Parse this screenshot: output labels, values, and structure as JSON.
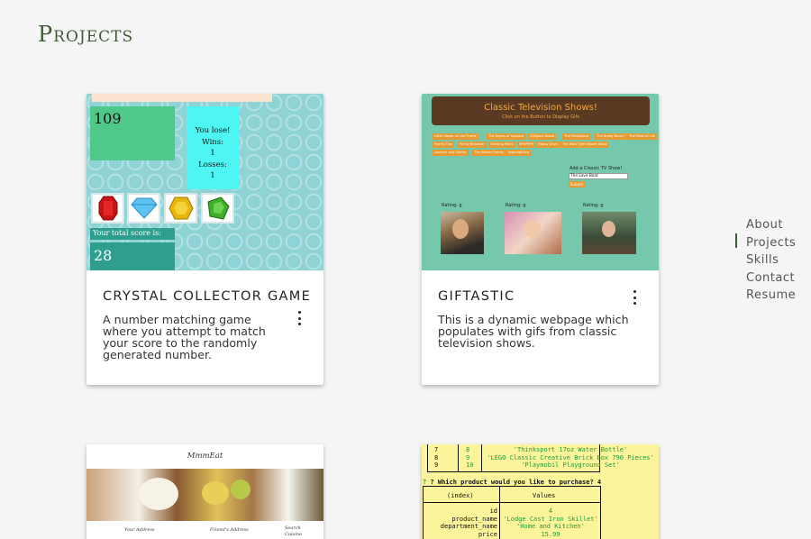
{
  "page_title": "Projects",
  "nav": {
    "items": [
      "About",
      "Projects",
      "Skills",
      "Contact",
      "Resume"
    ],
    "active": "Projects"
  },
  "projects": [
    {
      "title": "Crystal Collector Game",
      "description": "A number matching game where you attempt to match your score to the randomly generated number.",
      "thumbnail": {
        "target": "109",
        "lose": "You lose!",
        "wins_label": "Wins:",
        "wins": "1",
        "losses_label": "Losses:",
        "losses": "1",
        "score_label": "Your total score is:",
        "score": "28"
      }
    },
    {
      "title": "GIFTASTIC",
      "description": "This is a dynamic webpage which populates with gifs from classic television shows.",
      "thumbnail": {
        "heading": "Classic Television Shows!",
        "subheading": "Click on the Button to Display Gifs",
        "buttons": [
          "Little House on the Prairie",
          "The Dukes of Hazzard",
          "Gilligans Island",
          "The Flintstones",
          "The Brady Bunch",
          "The Facts of Life",
          "Family Ties",
          "Punky Brewster",
          "Growing Pains",
          "M*A*S*H",
          "Happy Days",
          "The Mary Tyler Moore Show",
          "Laverne and Shirley",
          "The Adams Family",
          "Moonlighting"
        ],
        "add_label": "Add a Classic TV Show!",
        "input_value": "The Love Boat",
        "submit": "Submit",
        "rating": "Rating: g"
      }
    },
    {
      "title": "",
      "thumbnail": {
        "brand": "MmmEat",
        "cols": [
          "Your Address",
          "Friend's Address",
          "Search Cuisine"
        ]
      }
    },
    {
      "title": "",
      "thumbnail": {
        "rows": [
          {
            "i": "7",
            "id": "8",
            "name": "'Thinksport 17oz Water Bottle'"
          },
          {
            "i": "8",
            "id": "9",
            "name": "'LEGO Classic Creative Brick Box 790 Pieces'"
          },
          {
            "i": "9",
            "id": "10",
            "name": "'Playmobil Playground Set'"
          }
        ],
        "prompt": "? Which product would you like to purchase? 4",
        "head_index": "(index)",
        "head_values": "Values",
        "fields": [
          {
            "k": "id",
            "v": "4"
          },
          {
            "k": "product_name",
            "v": "'Lodge Cast Iron Skillet'"
          },
          {
            "k": "department_name",
            "v": "'Home and Kitchen'"
          },
          {
            "k": "price",
            "v": "15.99"
          }
        ]
      }
    }
  ],
  "colors": {
    "title_green": "#3e5a36",
    "crystal_teal": "#8fd3d6",
    "gif_green": "#76c8ad",
    "terminal_yellow": "#fbf49a"
  }
}
